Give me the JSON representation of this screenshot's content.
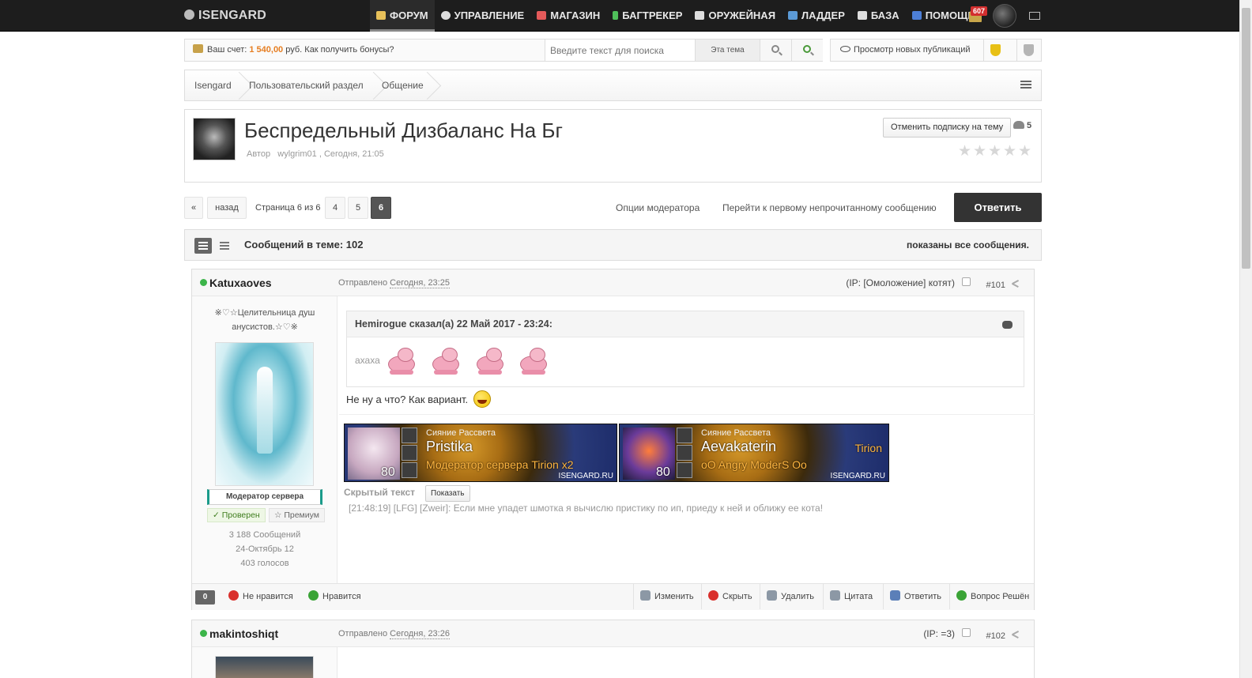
{
  "site": {
    "logo": "ISENGARD"
  },
  "nav": {
    "items": [
      {
        "label": "ФОРУМ",
        "icon": "forum-icon",
        "color": "#e8c15a"
      },
      {
        "label": "УПРАВЛЕНИЕ",
        "icon": "gear-icon",
        "color": "#dddddd"
      },
      {
        "label": "МАГАЗИН",
        "icon": "shop-icon",
        "color": "#e45a5a"
      },
      {
        "label": "БАГТРЕКЕР",
        "icon": "bug-icon",
        "color": "#4fbf5a"
      },
      {
        "label": "ОРУЖЕЙНАЯ",
        "icon": "armory-icon",
        "color": "#dddddd"
      },
      {
        "label": "ЛАДДЕР",
        "icon": "ladder-icon",
        "color": "#5b9ad6"
      },
      {
        "label": "БАЗА",
        "icon": "book-icon",
        "color": "#dddddd"
      },
      {
        "label": "ПОМОЩЬ",
        "icon": "help-icon",
        "color": "#4d7fd6"
      }
    ],
    "notifications_count": "607"
  },
  "infobar": {
    "wallet_prefix": "Ваш счет:",
    "wallet_amount": "1 540,00",
    "wallet_suffix": "руб. Как получить бонусы?",
    "search_placeholder": "Введите текст для поиска",
    "search_scope": "Эта тема",
    "new_posts": "Просмотр новых публикаций"
  },
  "breadcrumb": [
    "Isengard",
    "Пользовательский раздел",
    "Общение"
  ],
  "topic": {
    "title": "Беспредельный Дизбаланс На Бг",
    "author_label": "Автор",
    "author": "wylgrim01",
    "date": ", Сегодня, 21:05",
    "unsubscribe": "Отменить подписку на тему",
    "followers": "5"
  },
  "pagination": {
    "first": "«",
    "prev": "назад",
    "info": "Страница 6 из 6",
    "pages": [
      "4",
      "5",
      "6"
    ],
    "current": "6",
    "mod_options": "Опции модератора",
    "first_unread": "Перейти к первому непрочитанному сообщению",
    "reply": "Ответить"
  },
  "countbar": {
    "count": "Сообщений в теме: 102",
    "shown": "показаны все сообщения."
  },
  "posts": [
    {
      "author": "Katuxaoves",
      "sent_label": "Отправлено",
      "sent_time": "Сегодня, 23:25",
      "ip": "(IP: [Омоложение] котят)",
      "number": "#101",
      "user_title": "※♡☆Целительница душ анусистов.☆♡※",
      "role": "Модератор сервера",
      "verified": "✓ Проверен",
      "premium": "☆ Премиум",
      "messages": "3 188 Сообщений",
      "joined": "24-Октябрь 12",
      "votes": "403 голосов",
      "quote_cite": "Hemirogue сказал(а) 22 Май 2017 - 23:24:",
      "quote_text": "ахаха",
      "text": "Не ну а что? Как вариант.",
      "banners": [
        {
          "realm": "Сияние Рассвета",
          "name": "Pristika",
          "sub": "Модератор сервера Tirion x2",
          "server": "",
          "level": "80",
          "site": "ISENGARD.RU"
        },
        {
          "realm": "Сияние Рассвета",
          "name": "Aevakaterin",
          "sub": "oO Angry ModerS Oo",
          "server": "Tirion",
          "level": "80",
          "site": "ISENGARD.RU"
        }
      ],
      "spoiler_label": "Скрытый текст",
      "spoiler_button": "Показать",
      "signature_line": "[21:48:19] [LFG] [Zweir]: Если мне упадет шмотка я вычислю пристику по ип, приеду к ней и оближу ее кота!",
      "reputation": "0",
      "actions": {
        "dislike": "Не нравится",
        "like": "Нравится",
        "edit": "Изменить",
        "hide": "Скрыть",
        "delete": "Удалить",
        "quote": "Цитата",
        "reply": "Ответить",
        "solved": "Вопрос Решён"
      }
    },
    {
      "author": "makintoshiqt",
      "sent_label": "Отправлено",
      "sent_time": "Сегодня, 23:26",
      "ip": "(IP: =3)",
      "number": "#102"
    }
  ]
}
